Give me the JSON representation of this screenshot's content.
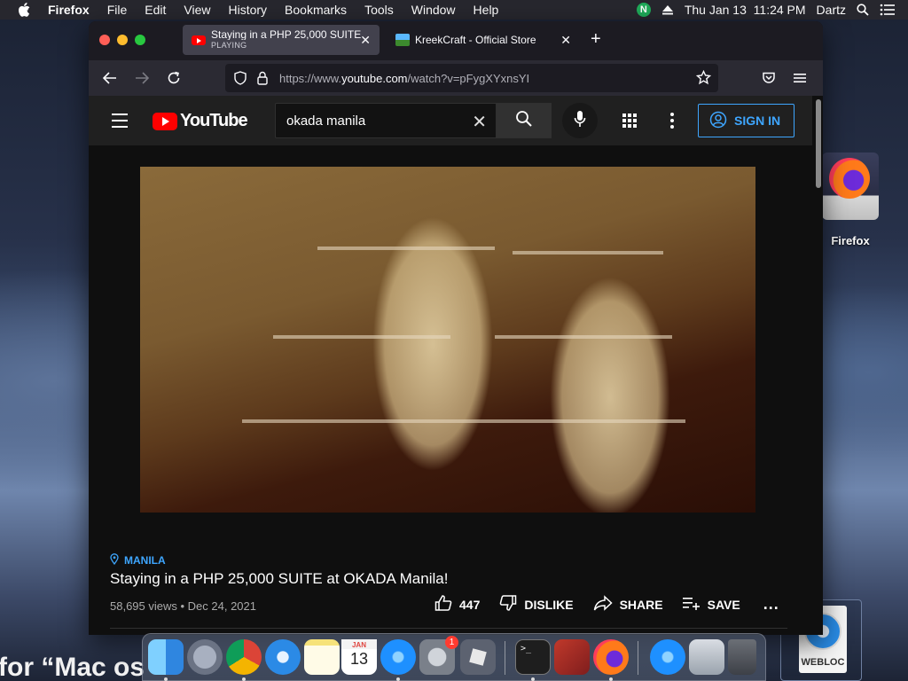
{
  "menubar": {
    "app_name": "Firefox",
    "items": [
      "File",
      "Edit",
      "View",
      "History",
      "Bookmarks",
      "Tools",
      "Window",
      "Help"
    ],
    "datetime": "Thu Jan 13  11:24 PM",
    "user": "Dartz",
    "n_badge": "N"
  },
  "desktop": {
    "icon_label": "Firefox",
    "webloc_label": "WEBLOC",
    "wallpaper_text": "for “Mac os"
  },
  "browser": {
    "tabs": [
      {
        "title": "Staying in a PHP 25,000 SUITE",
        "subtitle": "PLAYING",
        "favicon": "youtube-favicon",
        "active": true
      },
      {
        "title": "KreekCraft - Official Store",
        "favicon": "kreekcraft-favicon",
        "active": false
      }
    ],
    "url_prefix": "https://www.",
    "url_domain": "youtube.com",
    "url_path": "/watch?v=pFygXYxnsYI"
  },
  "youtube": {
    "logo_text": "YouTube",
    "search_query": "okada manila",
    "sign_in_label": "SIGN IN",
    "video": {
      "location": "MANILA",
      "title": "Staying in a PHP 25,000 SUITE at OKADA Manila!",
      "meta": "58,695 views • Dec 24, 2021",
      "likes": "447",
      "dislike_label": "DISLIKE",
      "share_label": "SHARE",
      "save_label": "SAVE",
      "more_label": "..."
    }
  },
  "dock": {
    "calendar_month": "JAN",
    "calendar_day": "13",
    "settings_badge": "1",
    "items": [
      "finder",
      "launchpad",
      "chrome",
      "safari",
      "notes",
      "calendar",
      "app-store",
      "system-preferences",
      "roblox",
      "terminal",
      "photo-booth",
      "firefox",
      "app-store-2",
      "preview",
      "trash"
    ]
  },
  "colors": {
    "accent_blue": "#3ea6ff",
    "youtube_red": "#ff0000",
    "menubar_bg": "#28282e"
  }
}
